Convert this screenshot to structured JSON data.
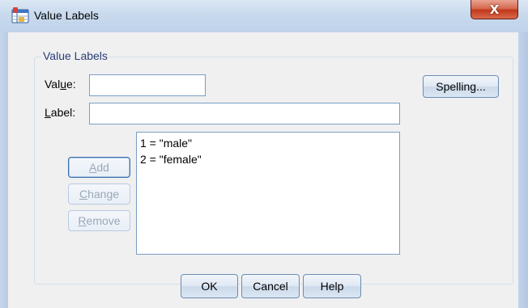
{
  "window": {
    "title": "Value Labels",
    "close_glyph": "X",
    "icon": "spss-data-table-icon"
  },
  "group": {
    "legend": "Value Labels"
  },
  "value_field": {
    "label_pre": "Val",
    "label_accel": "u",
    "label_post": "e:",
    "value": ""
  },
  "label_field": {
    "label_accel": "L",
    "label_post": "abel:",
    "value": ""
  },
  "buttons": {
    "spelling": "Spelling...",
    "add": {
      "accel": "A",
      "rest": "dd"
    },
    "change": {
      "accel": "C",
      "rest": "hange"
    },
    "remove": {
      "accel": "R",
      "rest": "emove"
    },
    "ok": "OK",
    "cancel": "Cancel",
    "help": "Help"
  },
  "value_labels_list": [
    "1 = \"male\"",
    "2 = \"female\""
  ],
  "colors": {
    "close_button": "#c2391c",
    "group_legend": "#2a3d7a",
    "dialog_bg": "#f0f0f0"
  }
}
